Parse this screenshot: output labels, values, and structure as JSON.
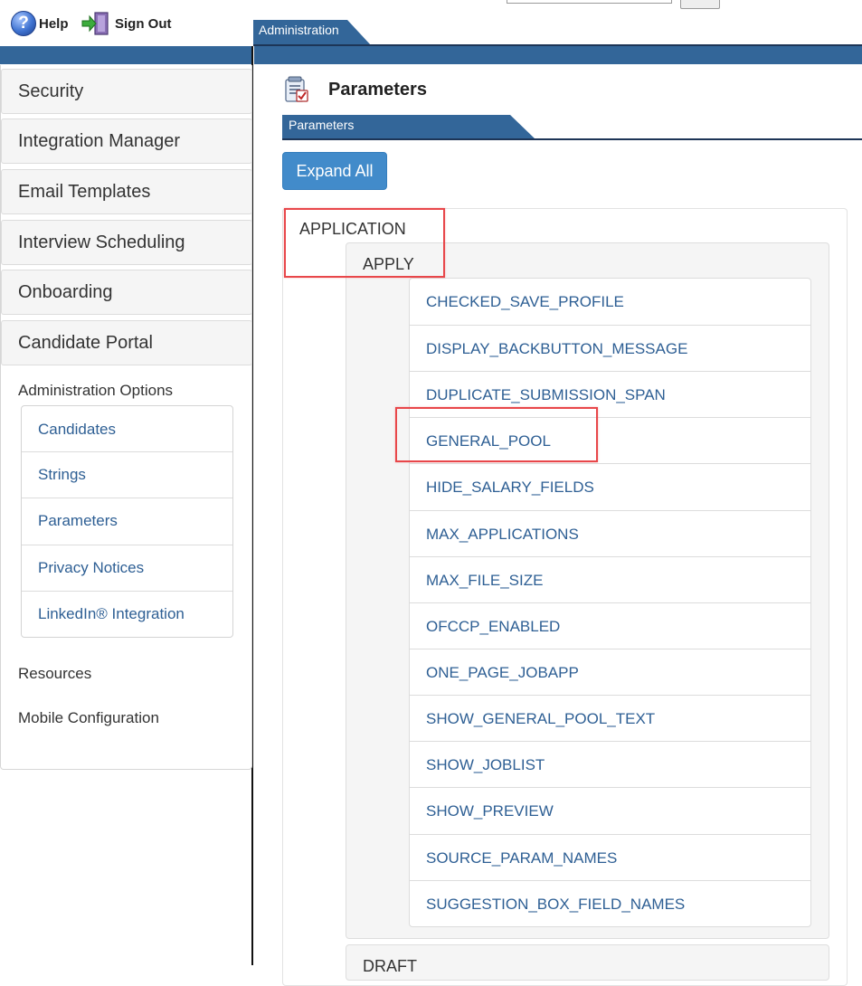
{
  "header": {
    "help_label": "Help",
    "signout_label": "Sign Out",
    "admin_tab_label": "Administration",
    "icons": {
      "help": "help-question-icon",
      "signout": "sign-out-door-icon"
    }
  },
  "sidebar": {
    "sections": [
      {
        "label": "Security"
      },
      {
        "label": "Integration Manager"
      },
      {
        "label": "Email Templates"
      },
      {
        "label": "Interview Scheduling"
      },
      {
        "label": "Onboarding"
      },
      {
        "label": "Candidate Portal"
      }
    ],
    "admin_options_label": "Administration Options",
    "admin_options": [
      {
        "label": "Candidates"
      },
      {
        "label": "Strings"
      },
      {
        "label": "Parameters"
      },
      {
        "label": "Privacy Notices"
      },
      {
        "label": "LinkedIn® Integration"
      }
    ],
    "extra_links": [
      {
        "label": "Resources"
      },
      {
        "label": "Mobile Configuration"
      }
    ]
  },
  "main": {
    "page_title": "Parameters",
    "page_icon": "parameters-list-icon",
    "tab_label": "Parameters",
    "expand_all_label": "Expand All",
    "category": {
      "label": "APPLICATION",
      "group": {
        "label": "APPLY",
        "parameters": [
          "CHECKED_SAVE_PROFILE",
          "DISPLAY_BACKBUTTON_MESSAGE",
          "DUPLICATE_SUBMISSION_SPAN",
          "GENERAL_POOL",
          "HIDE_SALARY_FIELDS",
          "MAX_APPLICATIONS",
          "MAX_FILE_SIZE",
          "OFCCP_ENABLED",
          "ONE_PAGE_JOBAPP",
          "SHOW_GENERAL_POOL_TEXT",
          "SHOW_JOBLIST",
          "SHOW_PREVIEW",
          "SOURCE_PARAM_NAMES",
          "SUGGESTION_BOX_FIELD_NAMES"
        ]
      },
      "next_group_label": "DRAFT"
    }
  },
  "colors": {
    "brand_blue": "#336699",
    "button_blue": "#428bca",
    "link_blue": "#2e5f94",
    "highlight_red": "#e8474a"
  }
}
